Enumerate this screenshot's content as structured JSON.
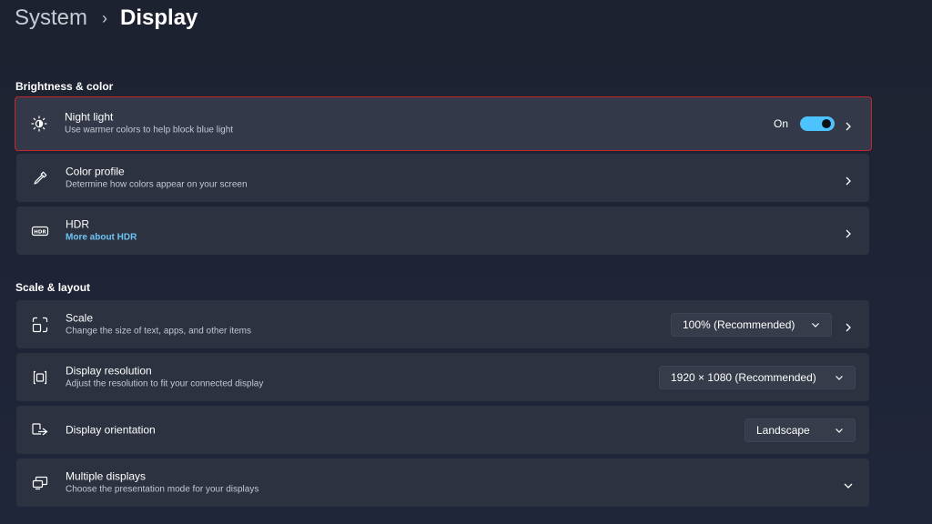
{
  "breadcrumb": {
    "root": "System",
    "separator": "›",
    "current": "Display"
  },
  "sections": {
    "brightness": "Brightness & color",
    "scale": "Scale & layout"
  },
  "night_light": {
    "title": "Night light",
    "subtitle": "Use warmer colors to help block blue light",
    "status": "On",
    "toggle_on": true,
    "icon": "brightness-sun-icon"
  },
  "color_profile": {
    "title": "Color profile",
    "subtitle": "Determine how colors appear on your screen",
    "icon": "eyedropper-icon"
  },
  "hdr": {
    "title": "HDR",
    "link": "More about HDR",
    "icon": "hdr-icon"
  },
  "scale": {
    "title": "Scale",
    "subtitle": "Change the size of text, apps, and other items",
    "value": "100% (Recommended)",
    "icon": "scale-icon"
  },
  "resolution": {
    "title": "Display resolution",
    "subtitle": "Adjust the resolution to fit your connected display",
    "value": "1920 × 1080 (Recommended)",
    "icon": "resolution-icon"
  },
  "orientation": {
    "title": "Display orientation",
    "value": "Landscape",
    "icon": "orientation-icon"
  },
  "multiple_displays": {
    "title": "Multiple displays",
    "subtitle": "Choose the presentation mode for your displays",
    "icon": "multiple-displays-icon"
  },
  "colors": {
    "accent": "#4cc2ff",
    "highlight_border": "#c2262b",
    "link": "#6fc3f5",
    "card": "#2c323f"
  }
}
